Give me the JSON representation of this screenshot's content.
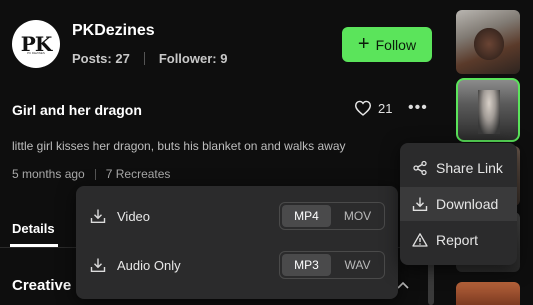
{
  "profile": {
    "username": "PKDezines",
    "avatar_monogram": "PK",
    "avatar_caption": "PK DEZINES",
    "posts_label": "Posts: 27",
    "followers_label": "Follower: 9",
    "follow_label": "Follow"
  },
  "post": {
    "title": "Girl and her dragon",
    "like_count": "21",
    "description": "little girl kisses her dragon, buts his blanket on and walks away",
    "age": "5 months ago",
    "recreates": "7 Recreates"
  },
  "tabs": {
    "details": "Details"
  },
  "section": {
    "creative": "Creative"
  },
  "download_popup": {
    "video_label": "Video",
    "video_formats": [
      "MP4",
      "MOV"
    ],
    "video_selected": "MP4",
    "audio_label": "Audio Only",
    "audio_formats": [
      "MP3",
      "WAV"
    ],
    "audio_selected": "MP3"
  },
  "context_menu": {
    "items": [
      {
        "label": "Share Link",
        "icon": "share-icon"
      },
      {
        "label": "Download",
        "icon": "download-icon"
      },
      {
        "label": "Report",
        "icon": "warning-icon"
      }
    ],
    "highlighted": "Download"
  },
  "colors": {
    "accent": "#5be45b",
    "background": "#0e0e0e",
    "menu_bg": "#2b2b2c"
  }
}
